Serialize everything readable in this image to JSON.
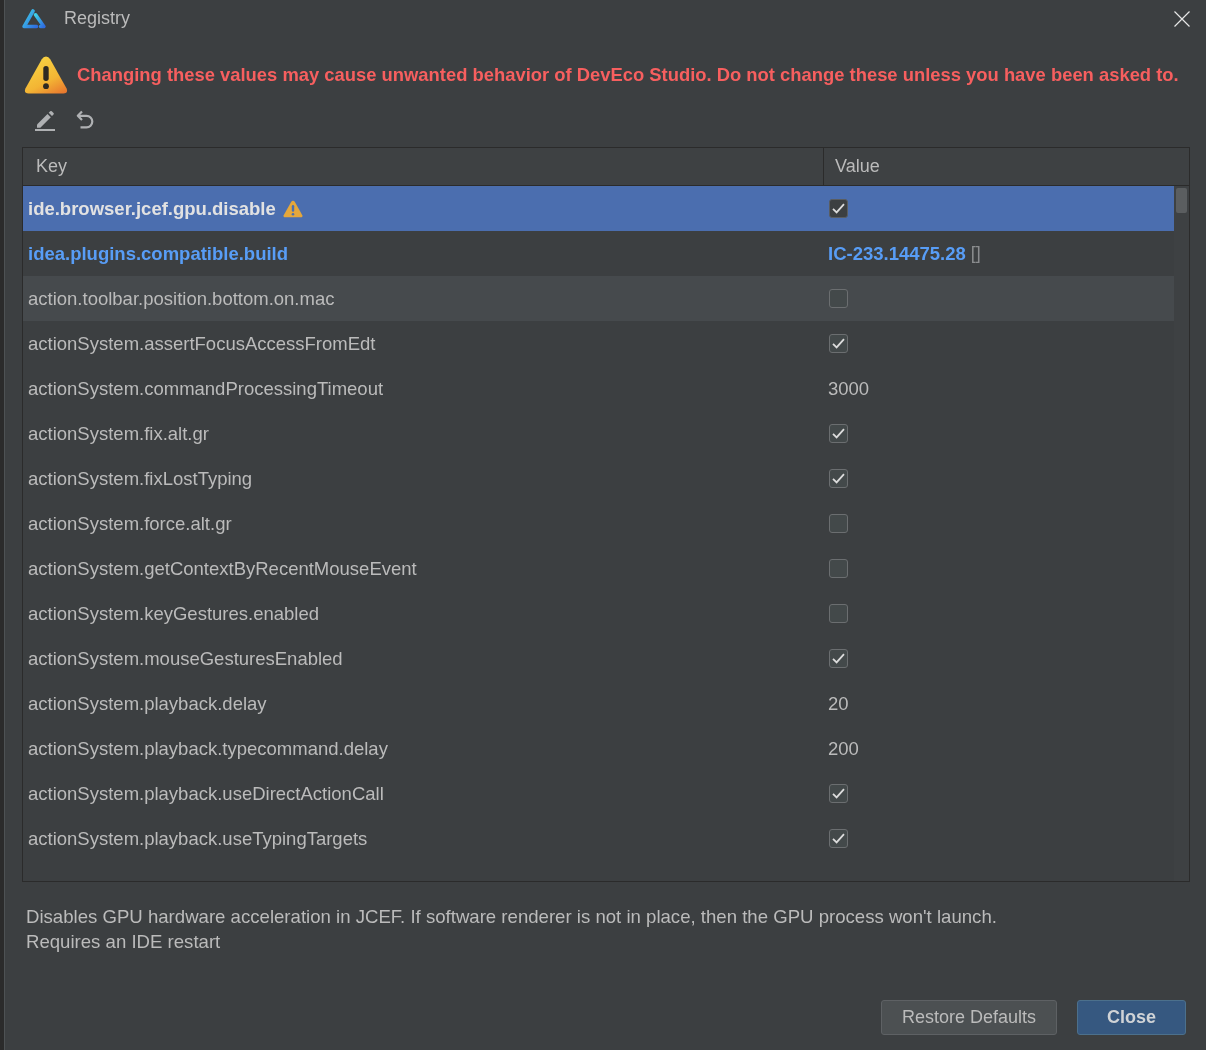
{
  "window": {
    "title": "Registry"
  },
  "warning": {
    "text": "Changing these values may cause unwanted behavior of DevEco Studio. Do not change these unless you have been asked to."
  },
  "table": {
    "columns": [
      "Key",
      "Value"
    ],
    "rows": [
      {
        "key": "ide.browser.jcef.gpu.disable",
        "kind": "checkbox",
        "checked": true,
        "selected": true,
        "hovered": false,
        "modified": true,
        "restart_required": true
      },
      {
        "key": "idea.plugins.compatible.build",
        "kind": "text",
        "value": "IC-233.14475.28",
        "suffix": "[]",
        "selected": false,
        "hovered": false,
        "modified": true,
        "restart_required": false
      },
      {
        "key": "action.toolbar.position.bottom.on.mac",
        "kind": "checkbox",
        "checked": false,
        "selected": false,
        "hovered": true,
        "modified": false,
        "restart_required": false
      },
      {
        "key": "actionSystem.assertFocusAccessFromEdt",
        "kind": "checkbox",
        "checked": true,
        "selected": false,
        "hovered": false,
        "modified": false,
        "restart_required": false
      },
      {
        "key": "actionSystem.commandProcessingTimeout",
        "kind": "text",
        "value": "3000",
        "selected": false,
        "hovered": false,
        "modified": false,
        "restart_required": false
      },
      {
        "key": "actionSystem.fix.alt.gr",
        "kind": "checkbox",
        "checked": true,
        "selected": false,
        "hovered": false,
        "modified": false,
        "restart_required": false
      },
      {
        "key": "actionSystem.fixLostTyping",
        "kind": "checkbox",
        "checked": true,
        "selected": false,
        "hovered": false,
        "modified": false,
        "restart_required": false
      },
      {
        "key": "actionSystem.force.alt.gr",
        "kind": "checkbox",
        "checked": false,
        "selected": false,
        "hovered": false,
        "modified": false,
        "restart_required": false
      },
      {
        "key": "actionSystem.getContextByRecentMouseEvent",
        "kind": "checkbox",
        "checked": false,
        "selected": false,
        "hovered": false,
        "modified": false,
        "restart_required": false
      },
      {
        "key": "actionSystem.keyGestures.enabled",
        "kind": "checkbox",
        "checked": false,
        "selected": false,
        "hovered": false,
        "modified": false,
        "restart_required": false
      },
      {
        "key": "actionSystem.mouseGesturesEnabled",
        "kind": "checkbox",
        "checked": true,
        "selected": false,
        "hovered": false,
        "modified": false,
        "restart_required": false
      },
      {
        "key": "actionSystem.playback.delay",
        "kind": "text",
        "value": "20",
        "selected": false,
        "hovered": false,
        "modified": false,
        "restart_required": false
      },
      {
        "key": "actionSystem.playback.typecommand.delay",
        "kind": "text",
        "value": "200",
        "selected": false,
        "hovered": false,
        "modified": false,
        "restart_required": false
      },
      {
        "key": "actionSystem.playback.useDirectActionCall",
        "kind": "checkbox",
        "checked": true,
        "selected": false,
        "hovered": false,
        "modified": false,
        "restart_required": false
      },
      {
        "key": "actionSystem.playback.useTypingTargets",
        "kind": "checkbox",
        "checked": true,
        "selected": false,
        "hovered": false,
        "modified": false,
        "restart_required": false
      }
    ]
  },
  "description": {
    "text": "Disables GPU hardware acceleration in JCEF. If software renderer is not in place, then the GPU process won't launch.",
    "note": "Requires an IDE restart"
  },
  "buttons": [
    {
      "label": "Restore Defaults",
      "default": false
    },
    {
      "label": "Close",
      "default": true
    }
  ]
}
